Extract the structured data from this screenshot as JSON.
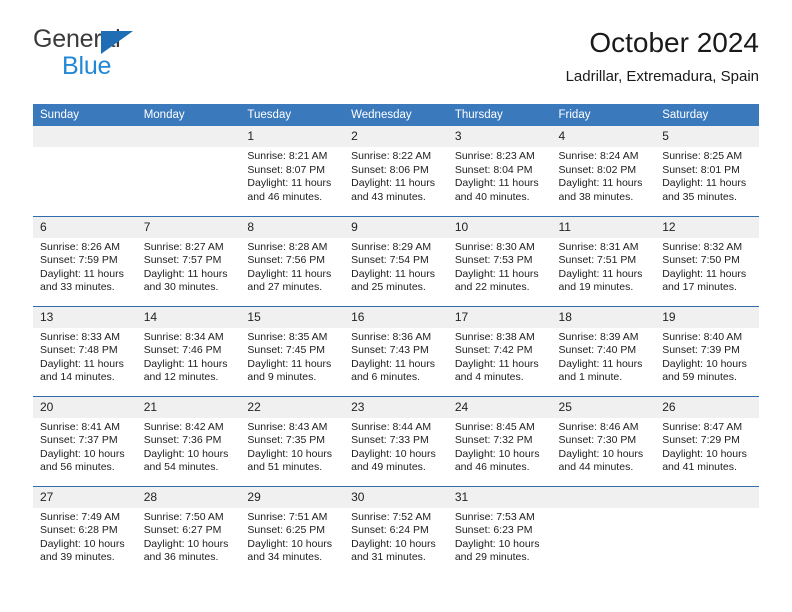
{
  "brand": {
    "line1": "General",
    "line2": "Blue",
    "triangle_color": "#1f6eb5",
    "blue_text_color": "#2288d6"
  },
  "header": {
    "title": "October 2024",
    "subtitle": "Ladrillar, Extremadura, Spain"
  },
  "theme": {
    "header_blue": "#3b79bd",
    "row_divider_blue": "#2f6daf",
    "daynum_band": "#f0f0f0"
  },
  "weekday_headers": [
    "Sunday",
    "Monday",
    "Tuesday",
    "Wednesday",
    "Thursday",
    "Friday",
    "Saturday"
  ],
  "labels": {
    "sunrise_prefix": "Sunrise:",
    "sunset_prefix": "Sunset:",
    "daylight_prefix": "Daylight:"
  },
  "weeks": [
    [
      {
        "day": "",
        "empty": true
      },
      {
        "day": "",
        "empty": true
      },
      {
        "day": "1",
        "sunrise": "Sunrise: 8:21 AM",
        "sunset": "Sunset: 8:07 PM",
        "daylight": "Daylight: 11 hours and 46 minutes."
      },
      {
        "day": "2",
        "sunrise": "Sunrise: 8:22 AM",
        "sunset": "Sunset: 8:06 PM",
        "daylight": "Daylight: 11 hours and 43 minutes."
      },
      {
        "day": "3",
        "sunrise": "Sunrise: 8:23 AM",
        "sunset": "Sunset: 8:04 PM",
        "daylight": "Daylight: 11 hours and 40 minutes."
      },
      {
        "day": "4",
        "sunrise": "Sunrise: 8:24 AM",
        "sunset": "Sunset: 8:02 PM",
        "daylight": "Daylight: 11 hours and 38 minutes."
      },
      {
        "day": "5",
        "sunrise": "Sunrise: 8:25 AM",
        "sunset": "Sunset: 8:01 PM",
        "daylight": "Daylight: 11 hours and 35 minutes."
      }
    ],
    [
      {
        "day": "6",
        "sunrise": "Sunrise: 8:26 AM",
        "sunset": "Sunset: 7:59 PM",
        "daylight": "Daylight: 11 hours and 33 minutes."
      },
      {
        "day": "7",
        "sunrise": "Sunrise: 8:27 AM",
        "sunset": "Sunset: 7:57 PM",
        "daylight": "Daylight: 11 hours and 30 minutes."
      },
      {
        "day": "8",
        "sunrise": "Sunrise: 8:28 AM",
        "sunset": "Sunset: 7:56 PM",
        "daylight": "Daylight: 11 hours and 27 minutes."
      },
      {
        "day": "9",
        "sunrise": "Sunrise: 8:29 AM",
        "sunset": "Sunset: 7:54 PM",
        "daylight": "Daylight: 11 hours and 25 minutes."
      },
      {
        "day": "10",
        "sunrise": "Sunrise: 8:30 AM",
        "sunset": "Sunset: 7:53 PM",
        "daylight": "Daylight: 11 hours and 22 minutes."
      },
      {
        "day": "11",
        "sunrise": "Sunrise: 8:31 AM",
        "sunset": "Sunset: 7:51 PM",
        "daylight": "Daylight: 11 hours and 19 minutes."
      },
      {
        "day": "12",
        "sunrise": "Sunrise: 8:32 AM",
        "sunset": "Sunset: 7:50 PM",
        "daylight": "Daylight: 11 hours and 17 minutes."
      }
    ],
    [
      {
        "day": "13",
        "sunrise": "Sunrise: 8:33 AM",
        "sunset": "Sunset: 7:48 PM",
        "daylight": "Daylight: 11 hours and 14 minutes."
      },
      {
        "day": "14",
        "sunrise": "Sunrise: 8:34 AM",
        "sunset": "Sunset: 7:46 PM",
        "daylight": "Daylight: 11 hours and 12 minutes."
      },
      {
        "day": "15",
        "sunrise": "Sunrise: 8:35 AM",
        "sunset": "Sunset: 7:45 PM",
        "daylight": "Daylight: 11 hours and 9 minutes."
      },
      {
        "day": "16",
        "sunrise": "Sunrise: 8:36 AM",
        "sunset": "Sunset: 7:43 PM",
        "daylight": "Daylight: 11 hours and 6 minutes."
      },
      {
        "day": "17",
        "sunrise": "Sunrise: 8:38 AM",
        "sunset": "Sunset: 7:42 PM",
        "daylight": "Daylight: 11 hours and 4 minutes."
      },
      {
        "day": "18",
        "sunrise": "Sunrise: 8:39 AM",
        "sunset": "Sunset: 7:40 PM",
        "daylight": "Daylight: 11 hours and 1 minute."
      },
      {
        "day": "19",
        "sunrise": "Sunrise: 8:40 AM",
        "sunset": "Sunset: 7:39 PM",
        "daylight": "Daylight: 10 hours and 59 minutes."
      }
    ],
    [
      {
        "day": "20",
        "sunrise": "Sunrise: 8:41 AM",
        "sunset": "Sunset: 7:37 PM",
        "daylight": "Daylight: 10 hours and 56 minutes."
      },
      {
        "day": "21",
        "sunrise": "Sunrise: 8:42 AM",
        "sunset": "Sunset: 7:36 PM",
        "daylight": "Daylight: 10 hours and 54 minutes."
      },
      {
        "day": "22",
        "sunrise": "Sunrise: 8:43 AM",
        "sunset": "Sunset: 7:35 PM",
        "daylight": "Daylight: 10 hours and 51 minutes."
      },
      {
        "day": "23",
        "sunrise": "Sunrise: 8:44 AM",
        "sunset": "Sunset: 7:33 PM",
        "daylight": "Daylight: 10 hours and 49 minutes."
      },
      {
        "day": "24",
        "sunrise": "Sunrise: 8:45 AM",
        "sunset": "Sunset: 7:32 PM",
        "daylight": "Daylight: 10 hours and 46 minutes."
      },
      {
        "day": "25",
        "sunrise": "Sunrise: 8:46 AM",
        "sunset": "Sunset: 7:30 PM",
        "daylight": "Daylight: 10 hours and 44 minutes."
      },
      {
        "day": "26",
        "sunrise": "Sunrise: 8:47 AM",
        "sunset": "Sunset: 7:29 PM",
        "daylight": "Daylight: 10 hours and 41 minutes."
      }
    ],
    [
      {
        "day": "27",
        "sunrise": "Sunrise: 7:49 AM",
        "sunset": "Sunset: 6:28 PM",
        "daylight": "Daylight: 10 hours and 39 minutes."
      },
      {
        "day": "28",
        "sunrise": "Sunrise: 7:50 AM",
        "sunset": "Sunset: 6:27 PM",
        "daylight": "Daylight: 10 hours and 36 minutes."
      },
      {
        "day": "29",
        "sunrise": "Sunrise: 7:51 AM",
        "sunset": "Sunset: 6:25 PM",
        "daylight": "Daylight: 10 hours and 34 minutes."
      },
      {
        "day": "30",
        "sunrise": "Sunrise: 7:52 AM",
        "sunset": "Sunset: 6:24 PM",
        "daylight": "Daylight: 10 hours and 31 minutes."
      },
      {
        "day": "31",
        "sunrise": "Sunrise: 7:53 AM",
        "sunset": "Sunset: 6:23 PM",
        "daylight": "Daylight: 10 hours and 29 minutes."
      },
      {
        "day": "",
        "empty": true
      },
      {
        "day": "",
        "empty": true
      }
    ]
  ]
}
